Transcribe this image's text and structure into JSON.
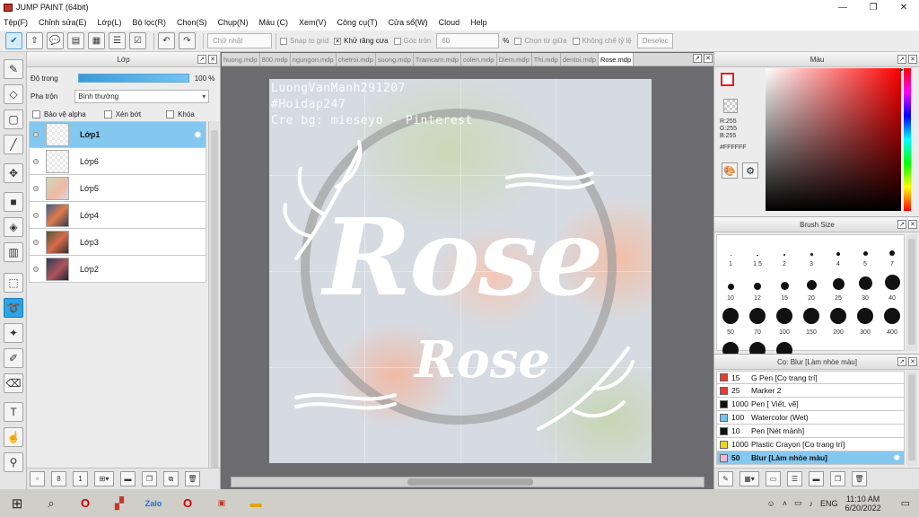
{
  "titlebar": {
    "title": "JUMP PAINT (64bit)",
    "minimize": "—",
    "restore": "❐",
    "close": "✕"
  },
  "menu": [
    "Tệp(F)",
    "Chỉnh sửa(E)",
    "Lớp(L)",
    "Bộ lọc(R)",
    "Chọn(S)",
    "Chụp(N)",
    "Màu (C)",
    "Xem(V)",
    "Công cụ(T)",
    "Cửa sổ(W)",
    "Cloud",
    "Help"
  ],
  "toolbar": {
    "shape_select": "Chữ nhật",
    "snap_to_grid": "Snap to grid",
    "antialias": "Khử răng cưa",
    "corner_round": "Góc tròn",
    "corner_value": "60",
    "percent": "%",
    "select_from_center": "Chọn từ giữa",
    "fixed_ratio": "Không chế tỷ lệ",
    "deselect": "Deselec"
  },
  "layer_panel": {
    "title": "Lớp",
    "opacity_label": "Độ trong",
    "opacity_value": "100 %",
    "opacity_level": 100,
    "blend_label": "Pha trộn",
    "blend_value": "Bình thường",
    "protect_alpha": "Bảo vệ alpha",
    "clipping": "Xén bớt",
    "lock": "Khóa",
    "layers": [
      {
        "name": "Lớp1",
        "selected": true
      },
      {
        "name": "Lớp6",
        "selected": false
      },
      {
        "name": "Lớp5",
        "selected": false
      },
      {
        "name": "Lớp4",
        "selected": false
      },
      {
        "name": "Lớp3",
        "selected": false
      },
      {
        "name": "Lớp2",
        "selected": false
      }
    ]
  },
  "doc_tabs": [
    "huong.mdp",
    "800.mdp",
    "ngungon.mdp",
    "chetroi.mdp",
    "suong.mdp",
    "Tramcam.mdp",
    "colen.mdp",
    "Diem.mdp",
    "Thi.mdp",
    "dentoi.mdp",
    "Rose.mdp"
  ],
  "active_tab": "Rose.mdp",
  "canvas": {
    "watermark_1": "LuongVanManh291207",
    "watermark_2": "#Hoidap247",
    "watermark_3": "Cre bg: mieseyo - Pinterest",
    "title_big": "Rose",
    "title_small": "Rose"
  },
  "color_panel": {
    "title": "Màu",
    "r": "R:255",
    "g": "G:255",
    "b": "B:255",
    "hex": "#FFFFFF",
    "fg_color": "#FFFFFF",
    "accent": "#E02020"
  },
  "brush_size": {
    "title": "Brush Size",
    "sizes": [
      "1",
      "1.5",
      "2",
      "3",
      "4",
      "5",
      "7",
      "10",
      "12",
      "15",
      "20",
      "25",
      "30",
      "40",
      "50",
      "70",
      "100",
      "150",
      "200",
      "300",
      "400",
      "",
      "",
      ""
    ]
  },
  "brush_preset": {
    "title": "Cọ: Blur [Làm nhòe màu]",
    "items": [
      {
        "size": "15",
        "name": "G Pen [Cọ trang trí]",
        "color": "#E53935",
        "selected": false
      },
      {
        "size": "25",
        "name": "Marker 2",
        "color": "#E53935",
        "selected": false
      },
      {
        "size": "1000",
        "name": "Pen [ Viết, vẽ]",
        "color": "#111111",
        "selected": false
      },
      {
        "size": "100",
        "name": "Watercolor (Wet)",
        "color": "#6EC6F0",
        "selected": false
      },
      {
        "size": "10",
        "name": "Pen [Nét mảnh]",
        "color": "#111111",
        "selected": false
      },
      {
        "size": "1000",
        "name": "Plastic Crayon [Cọ trang trí]",
        "color": "#F2D21A",
        "selected": false
      },
      {
        "size": "50",
        "name": "Blur [Làm nhòe màu]",
        "color": "#F4B6D6",
        "selected": true
      }
    ]
  },
  "taskbar": {
    "language": "ENG",
    "time": "11:10 AM",
    "date": "6/20/2022"
  }
}
